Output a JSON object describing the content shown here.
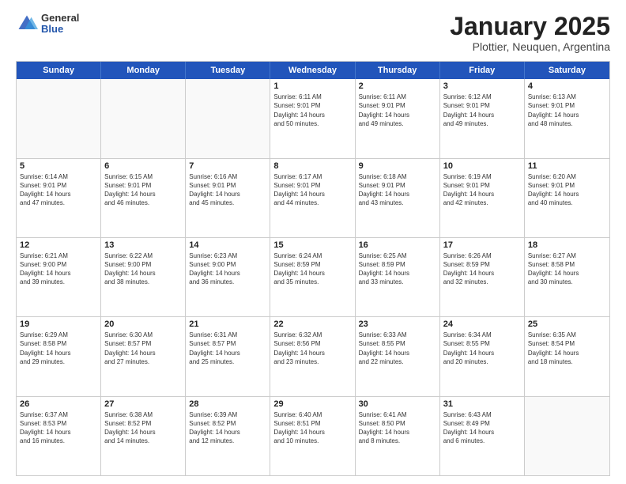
{
  "logo": {
    "general": "General",
    "blue": "Blue"
  },
  "header": {
    "month": "January 2025",
    "location": "Plottier, Neuquen, Argentina"
  },
  "days": [
    "Sunday",
    "Monday",
    "Tuesday",
    "Wednesday",
    "Thursday",
    "Friday",
    "Saturday"
  ],
  "weeks": [
    [
      {
        "day": "",
        "info": ""
      },
      {
        "day": "",
        "info": ""
      },
      {
        "day": "",
        "info": ""
      },
      {
        "day": "1",
        "info": "Sunrise: 6:11 AM\nSunset: 9:01 PM\nDaylight: 14 hours\nand 50 minutes."
      },
      {
        "day": "2",
        "info": "Sunrise: 6:11 AM\nSunset: 9:01 PM\nDaylight: 14 hours\nand 49 minutes."
      },
      {
        "day": "3",
        "info": "Sunrise: 6:12 AM\nSunset: 9:01 PM\nDaylight: 14 hours\nand 49 minutes."
      },
      {
        "day": "4",
        "info": "Sunrise: 6:13 AM\nSunset: 9:01 PM\nDaylight: 14 hours\nand 48 minutes."
      }
    ],
    [
      {
        "day": "5",
        "info": "Sunrise: 6:14 AM\nSunset: 9:01 PM\nDaylight: 14 hours\nand 47 minutes."
      },
      {
        "day": "6",
        "info": "Sunrise: 6:15 AM\nSunset: 9:01 PM\nDaylight: 14 hours\nand 46 minutes."
      },
      {
        "day": "7",
        "info": "Sunrise: 6:16 AM\nSunset: 9:01 PM\nDaylight: 14 hours\nand 45 minutes."
      },
      {
        "day": "8",
        "info": "Sunrise: 6:17 AM\nSunset: 9:01 PM\nDaylight: 14 hours\nand 44 minutes."
      },
      {
        "day": "9",
        "info": "Sunrise: 6:18 AM\nSunset: 9:01 PM\nDaylight: 14 hours\nand 43 minutes."
      },
      {
        "day": "10",
        "info": "Sunrise: 6:19 AM\nSunset: 9:01 PM\nDaylight: 14 hours\nand 42 minutes."
      },
      {
        "day": "11",
        "info": "Sunrise: 6:20 AM\nSunset: 9:01 PM\nDaylight: 14 hours\nand 40 minutes."
      }
    ],
    [
      {
        "day": "12",
        "info": "Sunrise: 6:21 AM\nSunset: 9:00 PM\nDaylight: 14 hours\nand 39 minutes."
      },
      {
        "day": "13",
        "info": "Sunrise: 6:22 AM\nSunset: 9:00 PM\nDaylight: 14 hours\nand 38 minutes."
      },
      {
        "day": "14",
        "info": "Sunrise: 6:23 AM\nSunset: 9:00 PM\nDaylight: 14 hours\nand 36 minutes."
      },
      {
        "day": "15",
        "info": "Sunrise: 6:24 AM\nSunset: 8:59 PM\nDaylight: 14 hours\nand 35 minutes."
      },
      {
        "day": "16",
        "info": "Sunrise: 6:25 AM\nSunset: 8:59 PM\nDaylight: 14 hours\nand 33 minutes."
      },
      {
        "day": "17",
        "info": "Sunrise: 6:26 AM\nSunset: 8:59 PM\nDaylight: 14 hours\nand 32 minutes."
      },
      {
        "day": "18",
        "info": "Sunrise: 6:27 AM\nSunset: 8:58 PM\nDaylight: 14 hours\nand 30 minutes."
      }
    ],
    [
      {
        "day": "19",
        "info": "Sunrise: 6:29 AM\nSunset: 8:58 PM\nDaylight: 14 hours\nand 29 minutes."
      },
      {
        "day": "20",
        "info": "Sunrise: 6:30 AM\nSunset: 8:57 PM\nDaylight: 14 hours\nand 27 minutes."
      },
      {
        "day": "21",
        "info": "Sunrise: 6:31 AM\nSunset: 8:57 PM\nDaylight: 14 hours\nand 25 minutes."
      },
      {
        "day": "22",
        "info": "Sunrise: 6:32 AM\nSunset: 8:56 PM\nDaylight: 14 hours\nand 23 minutes."
      },
      {
        "day": "23",
        "info": "Sunrise: 6:33 AM\nSunset: 8:55 PM\nDaylight: 14 hours\nand 22 minutes."
      },
      {
        "day": "24",
        "info": "Sunrise: 6:34 AM\nSunset: 8:55 PM\nDaylight: 14 hours\nand 20 minutes."
      },
      {
        "day": "25",
        "info": "Sunrise: 6:35 AM\nSunset: 8:54 PM\nDaylight: 14 hours\nand 18 minutes."
      }
    ],
    [
      {
        "day": "26",
        "info": "Sunrise: 6:37 AM\nSunset: 8:53 PM\nDaylight: 14 hours\nand 16 minutes."
      },
      {
        "day": "27",
        "info": "Sunrise: 6:38 AM\nSunset: 8:52 PM\nDaylight: 14 hours\nand 14 minutes."
      },
      {
        "day": "28",
        "info": "Sunrise: 6:39 AM\nSunset: 8:52 PM\nDaylight: 14 hours\nand 12 minutes."
      },
      {
        "day": "29",
        "info": "Sunrise: 6:40 AM\nSunset: 8:51 PM\nDaylight: 14 hours\nand 10 minutes."
      },
      {
        "day": "30",
        "info": "Sunrise: 6:41 AM\nSunset: 8:50 PM\nDaylight: 14 hours\nand 8 minutes."
      },
      {
        "day": "31",
        "info": "Sunrise: 6:43 AM\nSunset: 8:49 PM\nDaylight: 14 hours\nand 6 minutes."
      },
      {
        "day": "",
        "info": ""
      }
    ]
  ]
}
